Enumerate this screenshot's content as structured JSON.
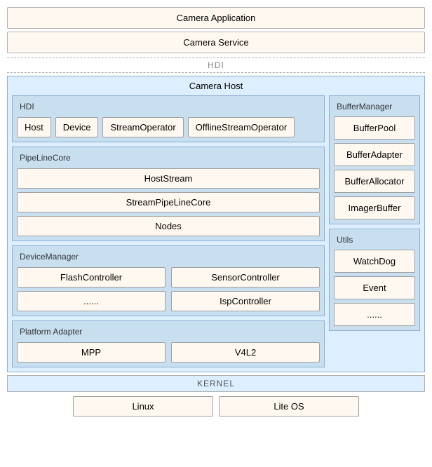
{
  "diagram": {
    "camera_application": "Camera Application",
    "camera_service": "Camera Service",
    "hdi_divider": "HDI",
    "camera_host_title": "Camera Host",
    "hdi_section": {
      "label": "HDI",
      "items": [
        "Host",
        "Device",
        "StreamOperator",
        "OfflineStreamOperator"
      ]
    },
    "pipeline_section": {
      "label": "PipeLineCore",
      "items": [
        "HostStream",
        "StreamPipeLineCore",
        "Nodes"
      ]
    },
    "device_manager": {
      "label": "DeviceManager",
      "row1": [
        "FlashController",
        "SensorController"
      ],
      "row2": [
        "......",
        "IspController"
      ]
    },
    "platform_adapter": {
      "label": "Platform Adapter",
      "items": [
        "MPP",
        "V4L2"
      ]
    },
    "buffer_manager": {
      "label": "BufferManager",
      "items": [
        "BufferPool",
        "BufferAdapter",
        "BufferAllocator",
        "ImagerBuffer"
      ]
    },
    "utils": {
      "label": "Utils",
      "items": [
        "WatchDog",
        "Event",
        "......"
      ]
    },
    "kernel": {
      "label": "KERNEL",
      "items": [
        "Linux",
        "Lite OS"
      ]
    }
  }
}
